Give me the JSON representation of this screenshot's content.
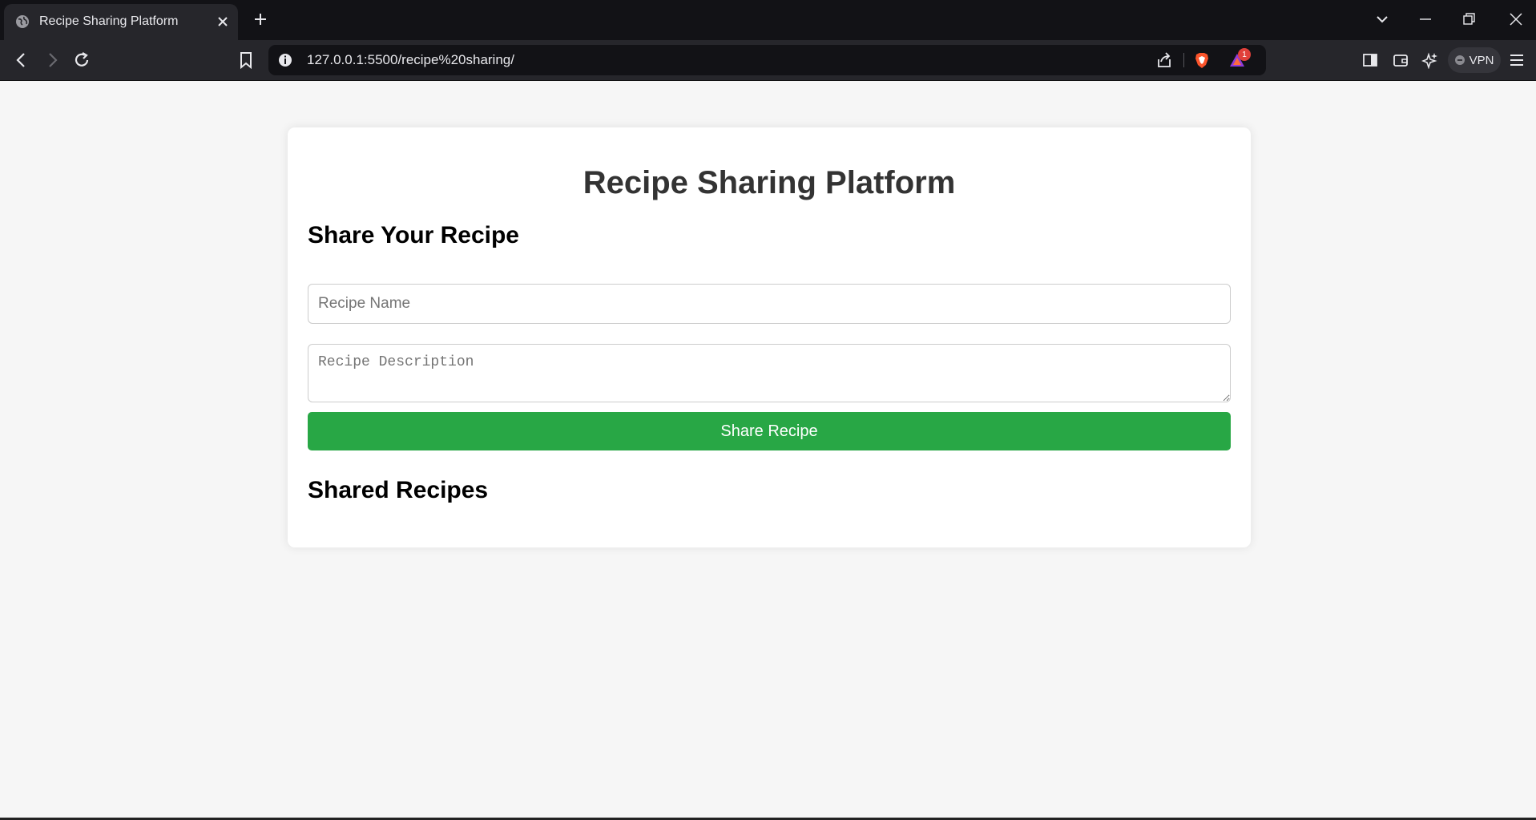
{
  "browser": {
    "tab": {
      "title": "Recipe Sharing Platform"
    },
    "address_bar": {
      "url": "127.0.0.1:5500/recipe%20sharing/"
    },
    "rewards_badge": "1",
    "vpn_label": "VPN",
    "icons": [
      "globe-icon",
      "close-icon",
      "plus-icon",
      "chevron-down-icon",
      "minimize-icon",
      "restore-icon",
      "window-close-icon",
      "back-icon",
      "forward-icon",
      "reload-icon",
      "bookmark-icon",
      "info-icon",
      "share-icon",
      "brave-shield-icon",
      "rewards-triangle-icon",
      "sidebar-icon",
      "wallet-icon",
      "leo-ai-icon",
      "menu-icon"
    ]
  },
  "page": {
    "title": "Recipe Sharing Platform",
    "share_section_heading": "Share Your Recipe",
    "recipe_name_placeholder": "Recipe Name",
    "recipe_name_value": "",
    "recipe_description_placeholder": "Recipe Description",
    "recipe_description_value": "",
    "share_button_label": "Share Recipe",
    "shared_section_heading": "Shared Recipes",
    "shared_recipes": []
  },
  "colors": {
    "page_background": "#f6f6f6",
    "card_background": "#ffffff",
    "title_text": "#333333",
    "share_button": "#28a745",
    "browser_chrome": "#121216"
  }
}
